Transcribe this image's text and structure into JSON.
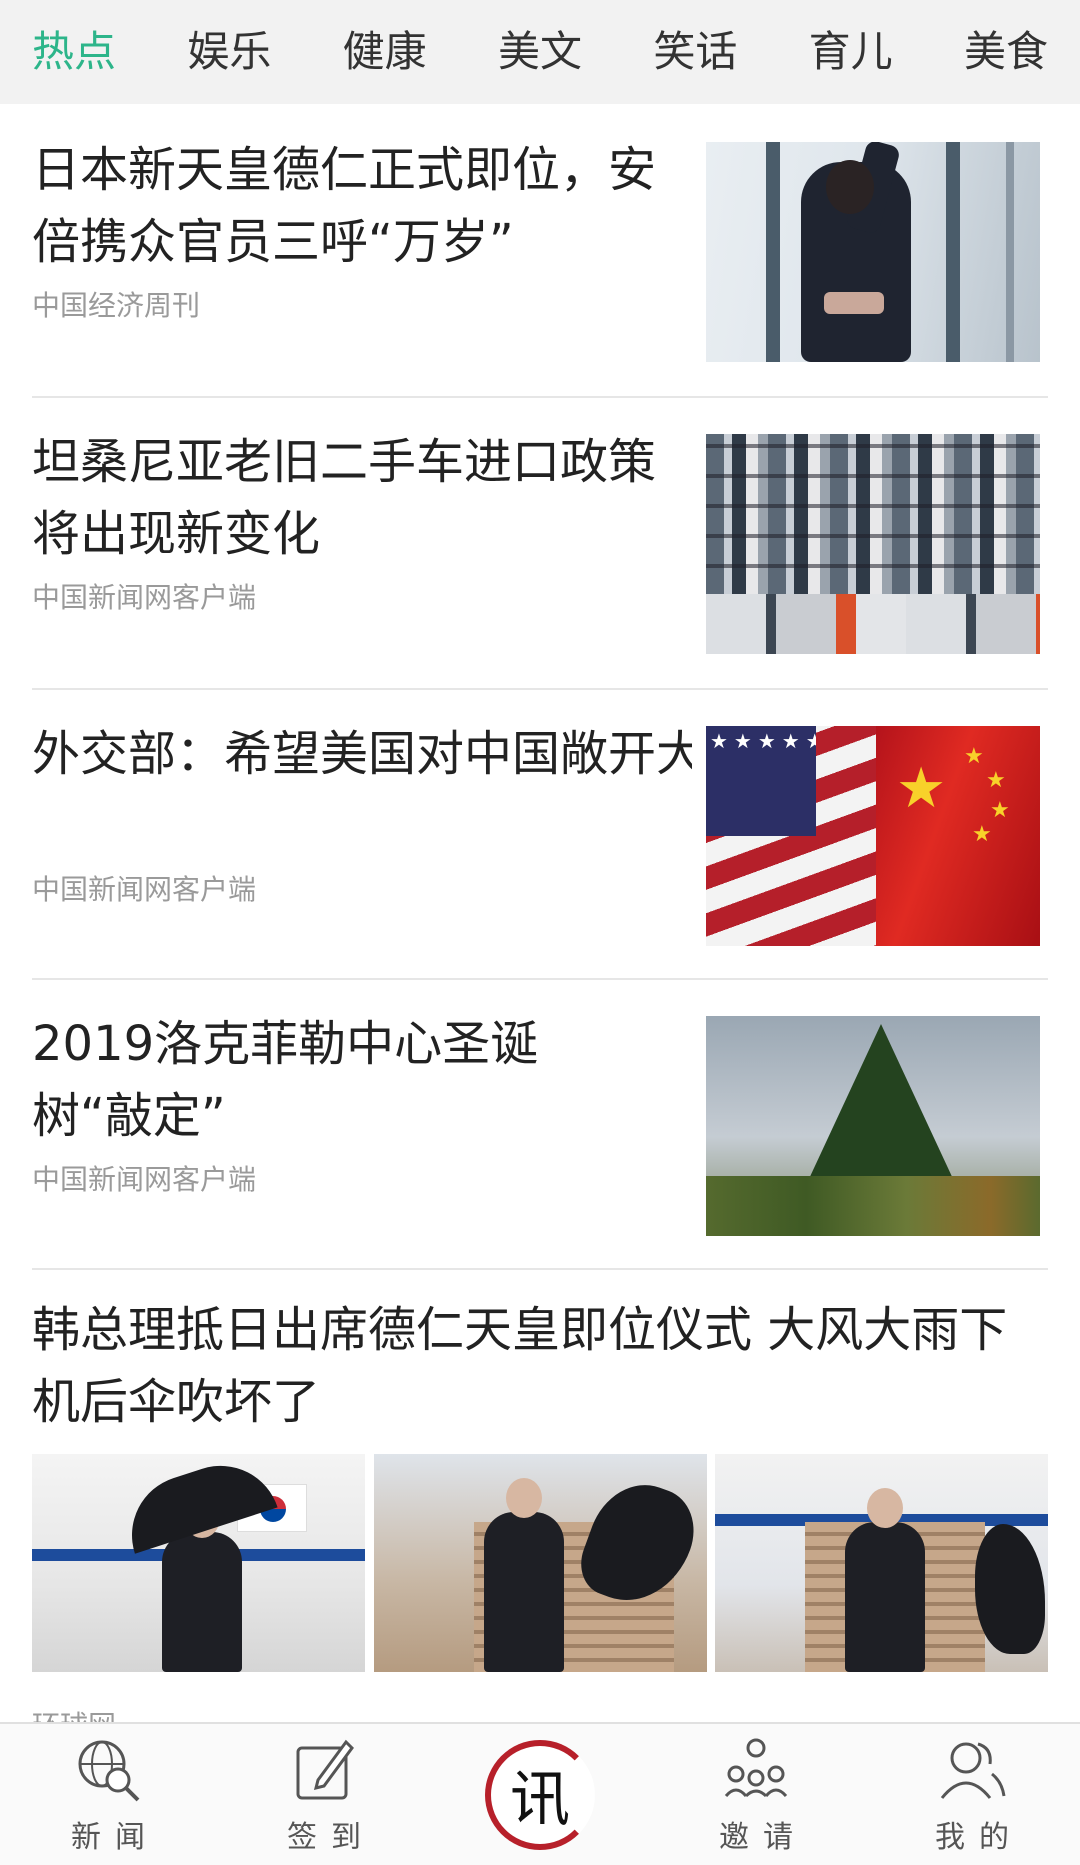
{
  "tabs": [
    {
      "label": "热点",
      "active": true
    },
    {
      "label": "娱乐",
      "active": false
    },
    {
      "label": "健康",
      "active": false
    },
    {
      "label": "美文",
      "active": false
    },
    {
      "label": "笑话",
      "active": false
    },
    {
      "label": "育儿",
      "active": false
    },
    {
      "label": "美食",
      "active": false
    }
  ],
  "colors": {
    "accent": "#2db58a",
    "logo_red": "#b7202a"
  },
  "feed": [
    {
      "title": "日本新天皇德仁正式即位，安倍携众官员三呼“万岁”",
      "source": "中国经济周刊"
    },
    {
      "title": "坦桑尼亚老旧二手车进口政策将出现新变化",
      "source": "中国新闻网客户端"
    },
    {
      "title": "外交部：希望美国对中国敞开大门，减少各种不合理…",
      "source": "中国新闻网客户端"
    },
    {
      "title": "2019洛克菲勒中心圣诞树“敲定”",
      "source": "中国新闻网客户端"
    },
    {
      "title": "韩总理抵日出席德仁天皇即位仪式 大风大雨下机后伞吹坏了",
      "source": "环球网"
    }
  ],
  "bottom_nav": [
    {
      "label": "新闻",
      "icon": "globe-search-icon"
    },
    {
      "label": "签到",
      "icon": "pencil-edit-icon"
    },
    {
      "label": "讯",
      "icon": "app-logo-icon"
    },
    {
      "label": "邀请",
      "icon": "people-network-icon"
    },
    {
      "label": "我的",
      "icon": "user-profile-icon"
    }
  ]
}
